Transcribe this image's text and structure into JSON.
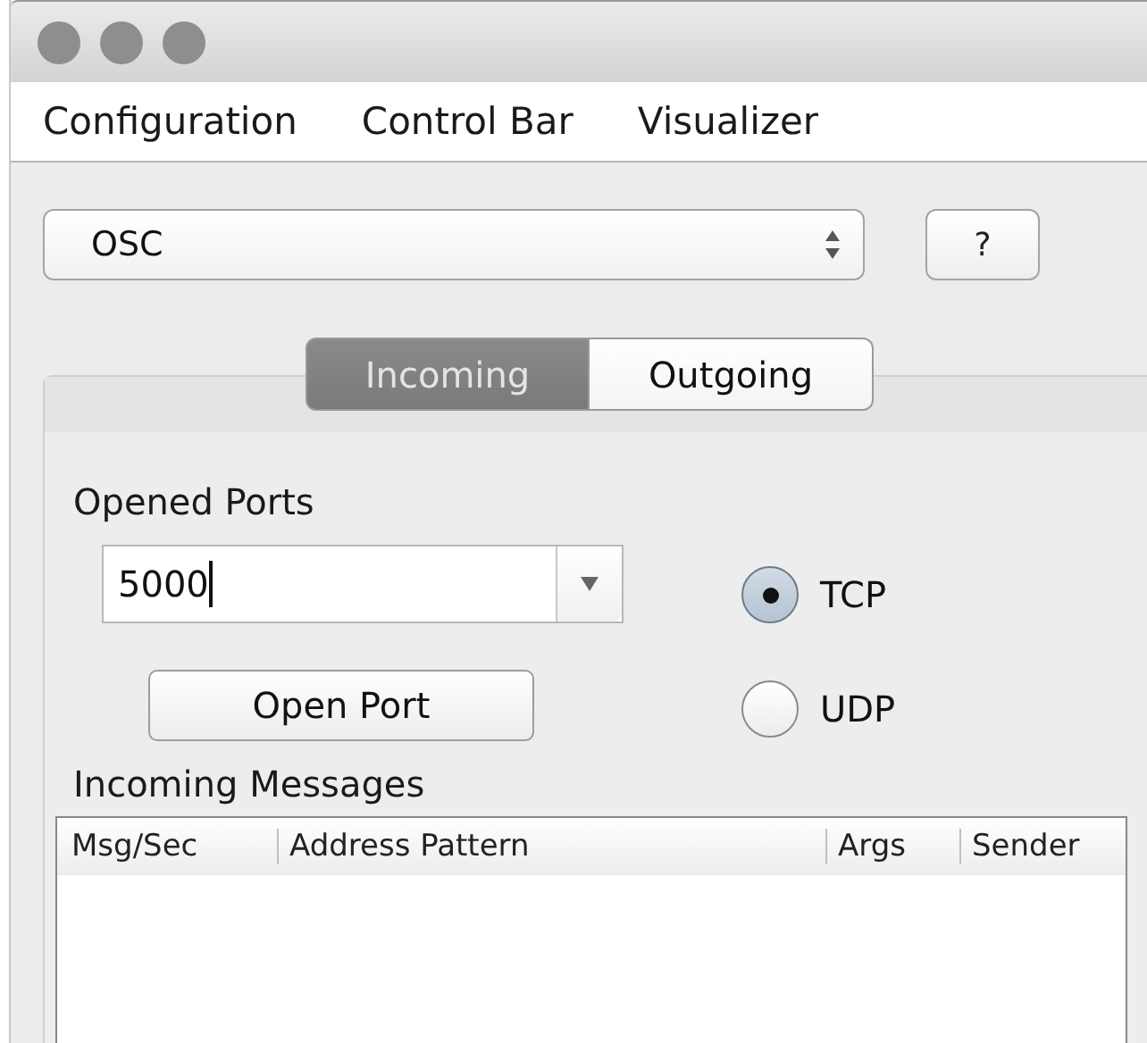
{
  "menu": [
    {
      "label": "Configuration"
    },
    {
      "label": "Control Bar"
    },
    {
      "label": "Visualizer"
    }
  ],
  "protocol_select": {
    "value": "OSC"
  },
  "help_button": {
    "label": "?"
  },
  "tabs": [
    {
      "label": "Incoming",
      "selected": true
    },
    {
      "label": "Outgoing",
      "selected": false
    }
  ],
  "opened_ports": {
    "label": "Opened Ports",
    "value": "5000"
  },
  "open_port_button": {
    "label": "Open Port"
  },
  "transport": [
    {
      "label": "TCP",
      "selected": true
    },
    {
      "label": "UDP",
      "selected": false
    }
  ],
  "incoming_messages": {
    "label": "Incoming Messages",
    "columns": [
      "Msg/Sec",
      "Address Pattern",
      "Args",
      "Sender"
    ]
  }
}
